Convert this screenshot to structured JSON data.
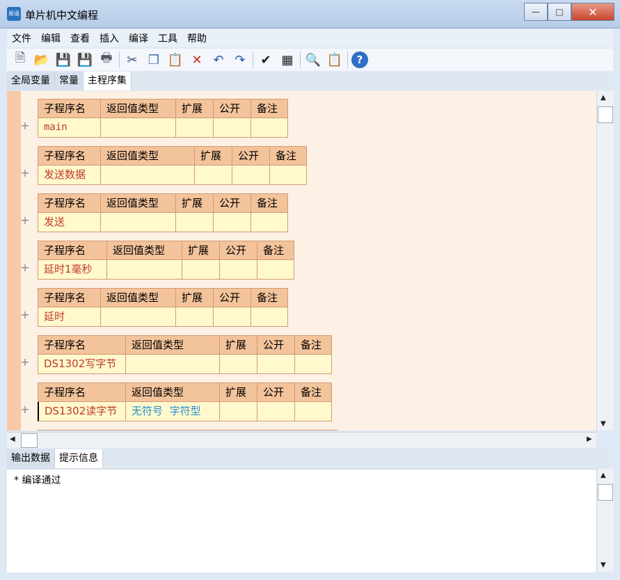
{
  "window": {
    "title": "单片机中文编程",
    "icon_label": "易语"
  },
  "menu": [
    "文件",
    "编辑",
    "查看",
    "插入",
    "编译",
    "工具",
    "帮助"
  ],
  "toolbar_icons": [
    "new-file-icon",
    "open-folder-icon",
    "save-icon",
    "save-all-icon",
    "print-icon",
    "cut-icon",
    "copy-icon",
    "paste-icon",
    "delete-icon",
    "undo-icon",
    "redo-icon",
    "check-compile-icon",
    "device-icon",
    "find-icon",
    "clipboard-icon",
    "help-icon"
  ],
  "top_tabs": [
    "全局变量",
    "常量",
    "主程序集"
  ],
  "table_headers": [
    "子程序名",
    "返回值类型",
    "扩展",
    "公开",
    "备注"
  ],
  "subroutines": [
    {
      "name": "main",
      "return_type": "",
      "return_type_2": ""
    },
    {
      "name": "发送数据",
      "return_type": "",
      "return_type_2": ""
    },
    {
      "name": "发送",
      "return_type": "",
      "return_type_2": ""
    },
    {
      "name": "延时1毫秒",
      "return_type": "",
      "return_type_2": ""
    },
    {
      "name": "延时",
      "return_type": "",
      "return_type_2": ""
    },
    {
      "name": "DS1302写字节",
      "return_type": "",
      "return_type_2": ""
    },
    {
      "name": "DS1302读字节",
      "return_type": "无符号",
      "return_type_2": "字符型"
    }
  ],
  "bottom_tabs": [
    "输出数据",
    "提示信息"
  ],
  "output": {
    "message": "* 编译通过"
  },
  "colors": {
    "header_cell": "#f3c39b",
    "value_cell": "#fff9cd",
    "name_text": "#c0392b",
    "type_text": "#2a8ed0",
    "editor_bg": "#fdf1e6"
  }
}
